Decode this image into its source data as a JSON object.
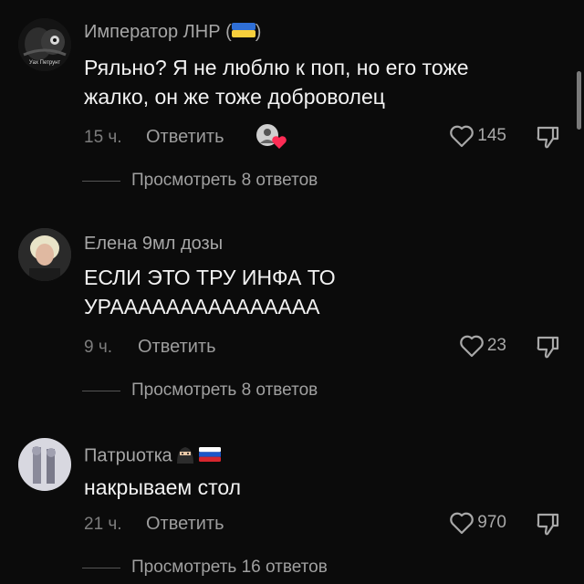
{
  "comments": [
    {
      "username": "Император ЛНР (",
      "username_suffix": ")",
      "username_flag": "ukraine-flag",
      "avatar_caption": "Уах Петрунт",
      "text": "Ряльно? Я не люблю к поп, но его тоже жалко, он же тоже доброволец",
      "time": "15 ч.",
      "reply_label": "Ответить",
      "likes": "145",
      "view_replies": "Просмотреть 8 ответов"
    },
    {
      "username": "Елена 9мл дозы",
      "text": "ЕСЛИ ЭТО ТРУ ИНФА ТО УРААААААААААААААА",
      "time": "9 ч.",
      "reply_label": "Ответить",
      "likes": "23",
      "view_replies": "Просмотреть 8 ответов"
    },
    {
      "username": "Пaтpuоткa",
      "username_badges": [
        "ninja-emoji",
        "russia-flag"
      ],
      "text": "накрываем стол",
      "time": "21 ч.",
      "reply_label": "Ответить",
      "likes": "970",
      "view_replies": "Просмотреть 16 ответов"
    }
  ],
  "icons": {
    "like": "heart-outline-icon",
    "dislike": "thumbs-down-icon",
    "creator_liked": "creator-liked-avatar-icon"
  },
  "colors": {
    "background": "#0b0b0b",
    "username": "#a6a6a6",
    "text": "#f2f2f2",
    "meta": "#7d7d7d",
    "liked_heart": "#fe2c55"
  }
}
